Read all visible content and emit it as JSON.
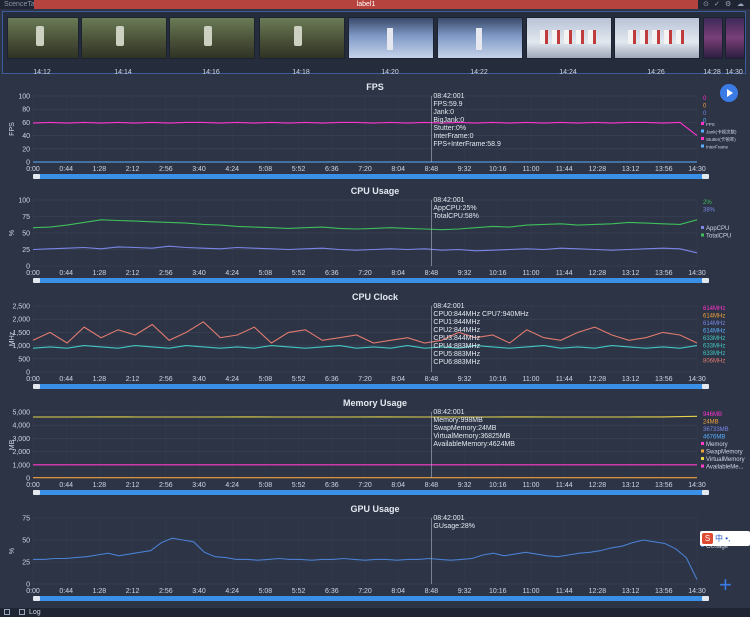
{
  "app": {
    "title": "ScenceTab",
    "label": "label1"
  },
  "thumbnails": [
    {
      "time": "14:12",
      "kind": "game"
    },
    {
      "time": "14:14",
      "kind": "game"
    },
    {
      "time": "14:16",
      "kind": "game"
    },
    {
      "time": "14:18",
      "kind": "game"
    },
    {
      "time": "14:20",
      "kind": "stage"
    },
    {
      "time": "14:22",
      "kind": "stage"
    },
    {
      "time": "14:24",
      "kind": "dance"
    },
    {
      "time": "14:26",
      "kind": "dance"
    },
    {
      "time": "14:28",
      "kind": "phone"
    },
    {
      "time": "14:30",
      "kind": "phone"
    }
  ],
  "x_ticks": [
    "0:00",
    "0:44",
    "1:28",
    "2:12",
    "2:56",
    "3:40",
    "4:24",
    "5:08",
    "5:52",
    "6:36",
    "7:20",
    "8:04",
    "8:48",
    "9:32",
    "10:16",
    "11:00",
    "11:44",
    "12:28",
    "13:12",
    "13:56",
    "14:30"
  ],
  "colors": {
    "fps": "#ff33cc",
    "cpu_app": "#7b86e6",
    "cpu_total": "#3fbf5a",
    "clock": "#e07a6e",
    "clock2": "#43c7c2",
    "memory": "#e6d34a",
    "gpu": "#4a7fd0",
    "accent": "#3a8fe6"
  },
  "chart_data": [
    {
      "type": "line",
      "title": "FPS",
      "ylabel": "FPS",
      "ylim": [
        0,
        100
      ],
      "y_ticks": [
        "100",
        "80",
        "60",
        "40",
        "20",
        "0"
      ],
      "series": [
        {
          "name": "FPS",
          "values": [
            59,
            60,
            59,
            60,
            59,
            60,
            59,
            60,
            59,
            60,
            60,
            59,
            60,
            59,
            60,
            59,
            60,
            59,
            60,
            60,
            59,
            60,
            59,
            60,
            59,
            60,
            59,
            60,
            59,
            60,
            59,
            60,
            59,
            60,
            59,
            60,
            60,
            59,
            60,
            40
          ]
        },
        {
          "name": "InterFrame",
          "values": [
            0,
            0,
            0,
            0,
            0,
            0,
            0,
            0,
            0,
            0,
            0,
            0,
            0,
            0,
            0,
            0,
            0,
            0,
            0,
            0,
            0,
            0,
            0,
            0,
            0,
            0,
            0,
            0,
            0,
            0,
            0,
            0,
            0,
            0,
            0,
            0,
            0,
            0,
            0,
            0
          ]
        }
      ],
      "cursor": {
        "time": "08:42:001",
        "lines": [
          "FPS:59.9",
          "Jank:0",
          "BigJank:0",
          "Stutter:0%",
          "InterFrame:0",
          "FPS+InterFrame:58.9"
        ]
      },
      "legend": [
        "FPS",
        "Jank(卡顿次数)",
        "Stutter(卡顿率)",
        "InterFrame"
      ],
      "right_values": [
        "0",
        "0",
        "0",
        "0"
      ]
    },
    {
      "type": "line",
      "title": "CPU Usage",
      "ylabel": "%",
      "ylim": [
        0,
        100
      ],
      "y_ticks": [
        "100",
        "75",
        "50",
        "25",
        "0"
      ],
      "series": [
        {
          "name": "AppCPU",
          "values": [
            25,
            26,
            27,
            28,
            26,
            29,
            28,
            27,
            30,
            28,
            27,
            26,
            28,
            27,
            26,
            25,
            26,
            27,
            25,
            24,
            25,
            26,
            25,
            26,
            24,
            25,
            23,
            24,
            25,
            26,
            25,
            27,
            26,
            25,
            24,
            25,
            26,
            27,
            26,
            20
          ]
        },
        {
          "name": "TotalCPU",
          "values": [
            58,
            59,
            62,
            66,
            70,
            69,
            68,
            67,
            66,
            65,
            63,
            62,
            60,
            59,
            58,
            57,
            58,
            59,
            57,
            56,
            57,
            58,
            57,
            56,
            55,
            56,
            58,
            60,
            59,
            62,
            63,
            64,
            62,
            63,
            64,
            66,
            65,
            64,
            63,
            70
          ]
        }
      ],
      "cursor": {
        "time": "08:42:001",
        "lines": [
          "AppCPU:25%",
          "TotalCPU:58%"
        ]
      },
      "legend": [
        "AppCPU",
        "TotalCPU"
      ],
      "right_values": [
        "2%",
        "38%"
      ]
    },
    {
      "type": "line",
      "title": "CPU Clock",
      "ylabel": "MHz",
      "ylim": [
        0,
        2500
      ],
      "y_ticks": [
        "2,500",
        "2,000",
        "1,500",
        "1,000",
        "500",
        "0"
      ],
      "series": [
        {
          "name": "CPU Clock",
          "values": [
            1200,
            1500,
            1100,
            1700,
            1300,
            1600,
            1400,
            1800,
            1200,
            1500,
            1900,
            1300,
            1400,
            1700,
            1100,
            1500,
            1600,
            1200,
            1300,
            1400,
            1100,
            1200,
            1300,
            1100,
            1200,
            1500,
            1300,
            1400,
            1100,
            1600,
            1300,
            1200,
            1500,
            1700,
            1400,
            1200,
            1300,
            1500,
            1400,
            1100
          ]
        },
        {
          "name": "CPU Clock 2",
          "values": [
            900,
            950,
            900,
            1000,
            950,
            900,
            1000,
            950,
            900,
            1000,
            950,
            900,
            950,
            900,
            1000,
            950,
            900,
            950,
            1000,
            900,
            950,
            900,
            1000,
            900,
            950,
            900,
            1000,
            950,
            900,
            950,
            1000,
            900,
            950,
            900,
            1000,
            950,
            900,
            950,
            900,
            1000
          ]
        }
      ],
      "cursor": {
        "time": "08:42:001",
        "lines": [
          "CPU0:844MHz CPU7:940MHz",
          "CPU1:844MHz",
          "CPU2:844MHz",
          "CPU3:844MHz",
          "CPU4:883MHz",
          "CPU5:883MHz",
          "CPU6:883MHz"
        ]
      },
      "right_values": [
        "614MHz",
        "614MHz",
        "614MHz",
        "614MHz",
        "633MHz",
        "633MHz",
        "633MHz",
        "806MHz"
      ]
    },
    {
      "type": "line",
      "title": "Memory Usage",
      "ylabel": "MB",
      "ylim": [
        0,
        5000
      ],
      "y_ticks": [
        "5,000",
        "4,000",
        "3,000",
        "2,000",
        "1,000",
        "0"
      ],
      "series": [
        {
          "name": "Memory",
          "values": [
            998,
            998,
            998,
            998,
            998,
            998,
            998,
            998,
            998,
            998,
            998,
            998,
            998,
            998,
            998,
            998,
            998,
            998,
            998,
            998
          ]
        },
        {
          "name": "SwapMemory",
          "values": [
            24,
            24,
            24,
            24,
            24,
            24,
            24,
            24,
            24,
            24,
            24,
            24,
            24,
            24,
            24,
            24,
            24,
            24,
            24,
            24
          ]
        },
        {
          "name": "AvailableMemory",
          "values": [
            4624,
            4620,
            4625,
            4624,
            4622,
            4624,
            4626,
            4624,
            4623,
            4624,
            4625,
            4624,
            4622,
            4624,
            4625,
            4624,
            4620,
            4624,
            4625,
            4676
          ]
        }
      ],
      "cursor": {
        "time": "08:42:001",
        "lines": [
          "Memory:998MB",
          "SwapMemory:24MB",
          "VirtualMemory:36825MB",
          "AvailableMemory:4624MB"
        ]
      },
      "legend": [
        "Memory",
        "SwapMemory",
        "VirtualMemory",
        "AvailableMe..."
      ],
      "right_values": [
        "946MB",
        "24MB",
        "36733MB",
        "4676MB"
      ]
    },
    {
      "type": "line",
      "title": "GPU Usage",
      "ylabel": "%",
      "ylim": [
        0,
        75
      ],
      "y_ticks": [
        "75",
        "50",
        "25",
        "0"
      ],
      "series": [
        {
          "name": "GUsage",
          "values": [
            28,
            28,
            29,
            29,
            30,
            31,
            33,
            35,
            32,
            34,
            36,
            38,
            47,
            52,
            50,
            48,
            36,
            31,
            30,
            28,
            28,
            27,
            28,
            29,
            28,
            28,
            27,
            28,
            28,
            29,
            28,
            27,
            28,
            28,
            27,
            28,
            28,
            29,
            28,
            27,
            28,
            29,
            33,
            35,
            32,
            34,
            36,
            34,
            32,
            31,
            33,
            35,
            36,
            38,
            41,
            43,
            47,
            50,
            48,
            46,
            40,
            30,
            5
          ]
        }
      ],
      "cursor": {
        "time": "08:42:001",
        "lines": [
          "GUsage:28%"
        ]
      },
      "legend": [
        "GUsage"
      ]
    }
  ],
  "ime": {
    "lang": "中",
    "dot": "•,"
  },
  "bottom": {
    "log": "Log"
  }
}
